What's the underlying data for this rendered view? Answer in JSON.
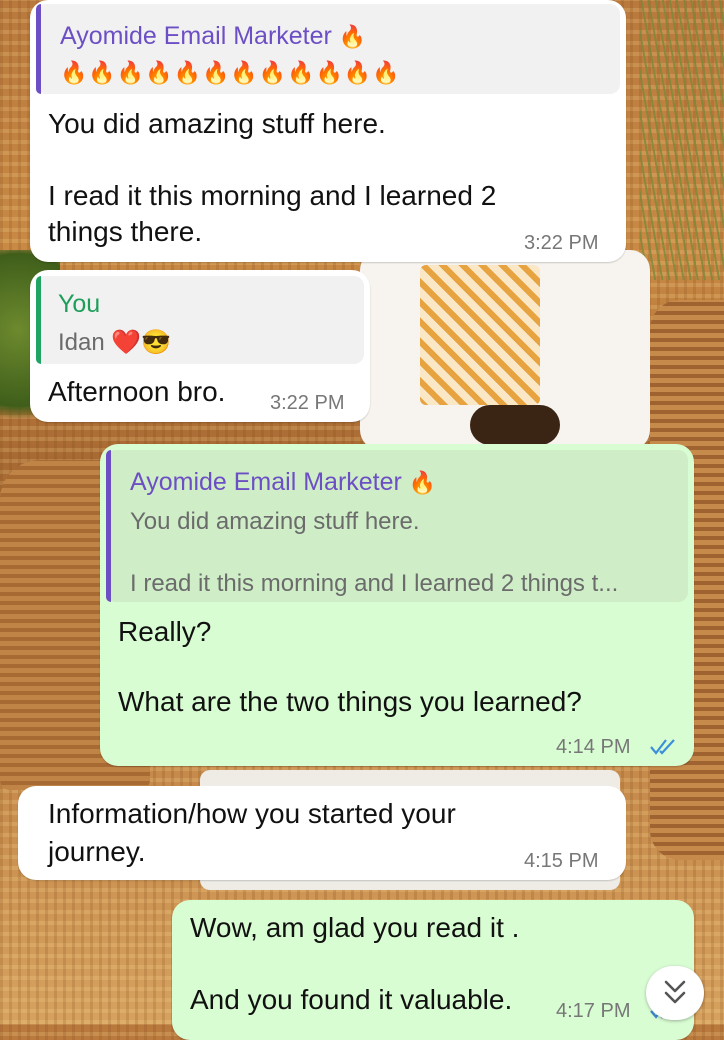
{
  "messages": [
    {
      "direction": "incoming",
      "quote": {
        "author": "Ayomide Email Marketer",
        "author_emoji": "🔥",
        "text": "🔥🔥🔥🔥🔥🔥🔥🔥🔥🔥🔥🔥"
      },
      "lines": [
        "You did amazing stuff here.",
        "",
        "I read it this morning and I learned 2",
        "things there."
      ],
      "time": "3:22 PM"
    },
    {
      "direction": "incoming",
      "quote": {
        "author": "You",
        "text": "Idan ❤️😎"
      },
      "lines": [
        "Afternoon bro."
      ],
      "time": "3:22 PM"
    },
    {
      "direction": "outgoing",
      "quote": {
        "author": "Ayomide Email Marketer",
        "author_emoji": "🔥",
        "line1": "You did amazing stuff here.",
        "line2": "I read it this morning and I learned 2 things t..."
      },
      "lines": [
        "Really?",
        "",
        "What are the two things you learned?"
      ],
      "time": "4:14 PM",
      "status": "read"
    },
    {
      "direction": "incoming",
      "lines": [
        "Information/how you started your",
        "journey."
      ],
      "time": "4:15 PM"
    },
    {
      "direction": "outgoing",
      "lines": [
        "Wow, am glad you read it .",
        "",
        "And you found it valuable."
      ],
      "time": "4:17 PM",
      "status": "read"
    }
  ],
  "icons": {
    "read_ticks": "double-check-icon",
    "scroll_down": "double-chevron-down-icon"
  },
  "colors": {
    "incoming_bubble": "#ffffff",
    "outgoing_bubble": "#d9fdd3",
    "quote_author_purple": "#6c4fc4",
    "quote_author_green": "#1e9e5a",
    "read_ticks": "#3b8fd9"
  }
}
